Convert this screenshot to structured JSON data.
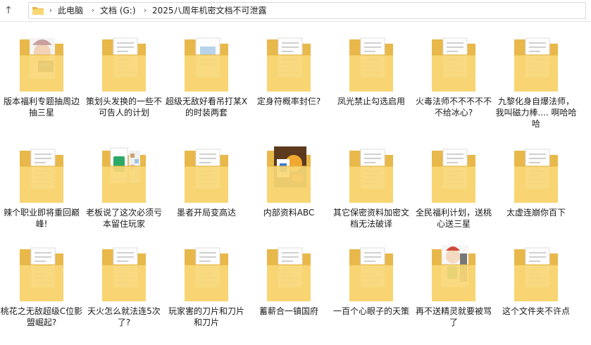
{
  "nav": {
    "back_icon": "back-arrow-icon",
    "forward_icon": "forward-arrow-icon",
    "up_icon": "up-arrow-icon"
  },
  "address": {
    "icon": "folder-icon",
    "crumbs": [
      "此电脑",
      "文档 (G:)",
      "2025八周年机密文档不可泄露"
    ]
  },
  "colors": {
    "folder_back": "#e8b84a",
    "folder_front": "#f8d775",
    "folder_edge": "#e3b440"
  },
  "folders": [
    {
      "name": "版本福利专题抽周边抽三星",
      "preview": "character-portrait"
    },
    {
      "name": "策划头发换的一些不可告人的计划",
      "preview": "document"
    },
    {
      "name": "超级无敌好看吊打某X的时装两套",
      "preview": "document-blue"
    },
    {
      "name": "定身符概率封仨?",
      "preview": "document"
    },
    {
      "name": "凤光禁止勾选启用",
      "preview": "document"
    },
    {
      "name": "火毒法师不不不不不不给冰心?",
      "preview": "document"
    },
    {
      "name": "九黎化身自爆法师，我叫磁力棒.... 啊哈哈哈",
      "preview": "document"
    },
    {
      "name": "辣个职业即将重回巅峰!",
      "preview": "document"
    },
    {
      "name": "老板说了这次必须亏本留住玩家",
      "preview": "green-card"
    },
    {
      "name": "墨者开局变高达",
      "preview": "document"
    },
    {
      "name": "内部资料ABC",
      "preview": "poster"
    },
    {
      "name": "其它保密资料加密文档无法破译",
      "preview": "document"
    },
    {
      "name": "全民福利计划，送桃心送三星",
      "preview": "document"
    },
    {
      "name": "太虚连崩你百下",
      "preview": "document"
    },
    {
      "name": "桃花之无敌超级C位影盟崛起?",
      "preview": "document"
    },
    {
      "name": "天火怎么就法连5次了?",
      "preview": "document"
    },
    {
      "name": "玩家害的刀片和刀片和刀片",
      "preview": "document"
    },
    {
      "name": "蓄薪合一镇国府",
      "preview": "document"
    },
    {
      "name": "一百个心眼子的天策",
      "preview": "document"
    },
    {
      "name": "再不送精灵就要被骂了",
      "preview": "character-green"
    },
    {
      "name": "这个文件夹不许点",
      "preview": "document"
    }
  ]
}
